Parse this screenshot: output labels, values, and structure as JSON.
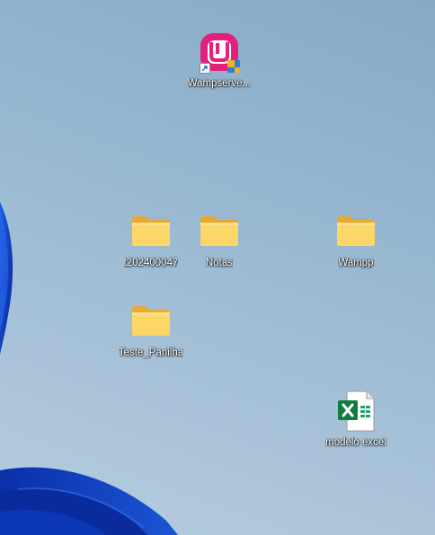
{
  "desktop": {
    "icons": [
      {
        "label": "Wampserve...",
        "type": "shortcut",
        "icon": "wampserver-icon"
      },
      {
        "label": "t202400047",
        "type": "folder",
        "icon": "folder-icon"
      },
      {
        "label": "Notas",
        "type": "folder",
        "icon": "folder-icon"
      },
      {
        "label": "Wampp",
        "type": "folder",
        "icon": "folder-icon"
      },
      {
        "label": "Teste_Panilha",
        "type": "folder",
        "icon": "folder-icon"
      },
      {
        "label": "modelo excel",
        "type": "file",
        "icon": "excel-file-icon"
      }
    ]
  },
  "colors": {
    "wallpaper_sky": "#98b8d0",
    "wallpaper_bloom": "#0a3fb8",
    "folder_yellow": "#fcd667",
    "excel_green": "#107c41",
    "wamp_pink": "#e6207a"
  }
}
